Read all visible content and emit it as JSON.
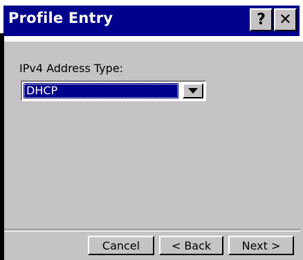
{
  "window": {
    "title": "Profile Entry",
    "help_label": "?",
    "close_label": "✕"
  },
  "form": {
    "address_type_label": "IPv4 Address Type:",
    "address_type_value": "DHCP"
  },
  "footer": {
    "cancel_label": "Cancel",
    "back_label": "< Back",
    "next_label": "Next >"
  },
  "colors": {
    "titlebar": "#00008c",
    "face": "#c6c3c6",
    "selection": "#00008c"
  },
  "icons": [
    "help-icon",
    "close-icon",
    "dropdown-arrow-icon"
  ]
}
